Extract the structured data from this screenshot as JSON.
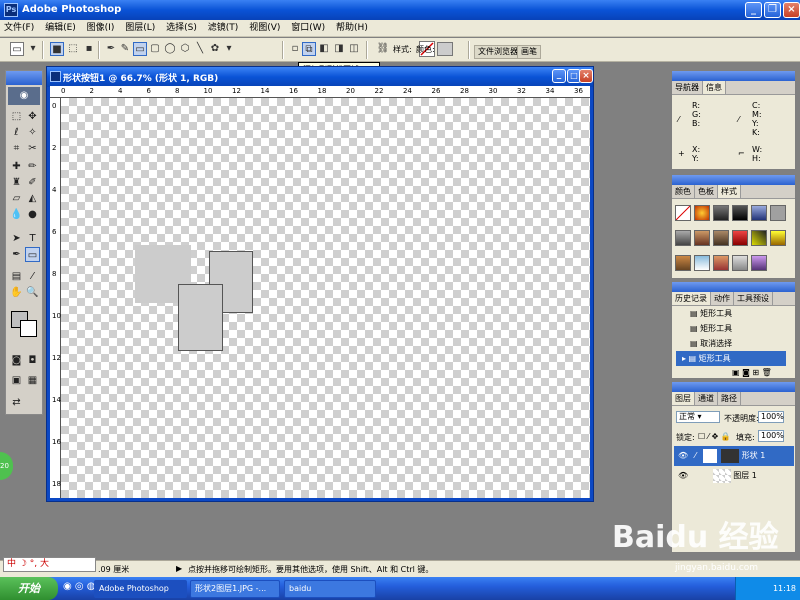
{
  "app": {
    "title": "Adobe Photoshop",
    "icon": "photoshop-logo-icon"
  },
  "menu": [
    "文件(F)",
    "编辑(E)",
    "图像(I)",
    "图层(L)",
    "选择(S)",
    "滤镜(T)",
    "视图(V)",
    "窗口(W)",
    "帮助(H)"
  ],
  "options": {
    "tooltip": "添加到形状区域 (+)",
    "style_label": "样式:",
    "color_label": "颜色:"
  },
  "well_tabs": [
    "文件浏览器",
    "画笔"
  ],
  "document": {
    "title": "形状按钮1 @ 66.7% (形状 1, RGB)"
  },
  "ruler": {
    "h": [
      "0",
      "2",
      "4",
      "6",
      "8",
      "10",
      "12",
      "14",
      "16",
      "18",
      "20",
      "22",
      "24",
      "26",
      "28",
      "30",
      "32",
      "34",
      "36"
    ],
    "v": [
      "0",
      "2",
      "4",
      "6",
      "8",
      "10",
      "12",
      "14",
      "16",
      "18"
    ]
  },
  "navigator": {
    "tabs": [
      "导航器",
      "信息"
    ],
    "rgb": "R:\nG:\nB:",
    "cmyk": "C:\nM:\nY:\nK:",
    "xy": "X:\nY:",
    "wh": "W:\nH:"
  },
  "color_panel": {
    "tabs": [
      "颜色",
      "色板",
      "样式"
    ]
  },
  "history_panel": {
    "tabs": [
      "历史记录",
      "动作",
      "工具预设"
    ],
    "items": [
      "矩形工具",
      "矩形工具",
      "取消选择",
      "矩形工具"
    ]
  },
  "layers_panel": {
    "tabs": [
      "图层",
      "通道",
      "路径"
    ],
    "blend_mode": "正常",
    "opacity_label": "不透明度:",
    "opacity": "100%",
    "lock_label": "锁定:",
    "fill_label": "填充:",
    "fill": "100%",
    "layers": [
      "形状 1",
      "图层 1"
    ]
  },
  "status": {
    "zoom": ".09 厘米",
    "hint": "点按并拖移可绘制矩形。要用其他选项，使用 Shift、Alt 和 Ctrl 键。"
  },
  "ime": {
    "text": "中 ☽ °, 大"
  },
  "taskbar": {
    "start": "开始",
    "tasks": [
      "Adobe Photoshop",
      "形状2图层1.JPG -...",
      "baidu"
    ],
    "time": "11:18"
  },
  "watermark": {
    "brand": "Baidu 经验",
    "url": "jingyan.baidu.com"
  },
  "side_badge": "20"
}
